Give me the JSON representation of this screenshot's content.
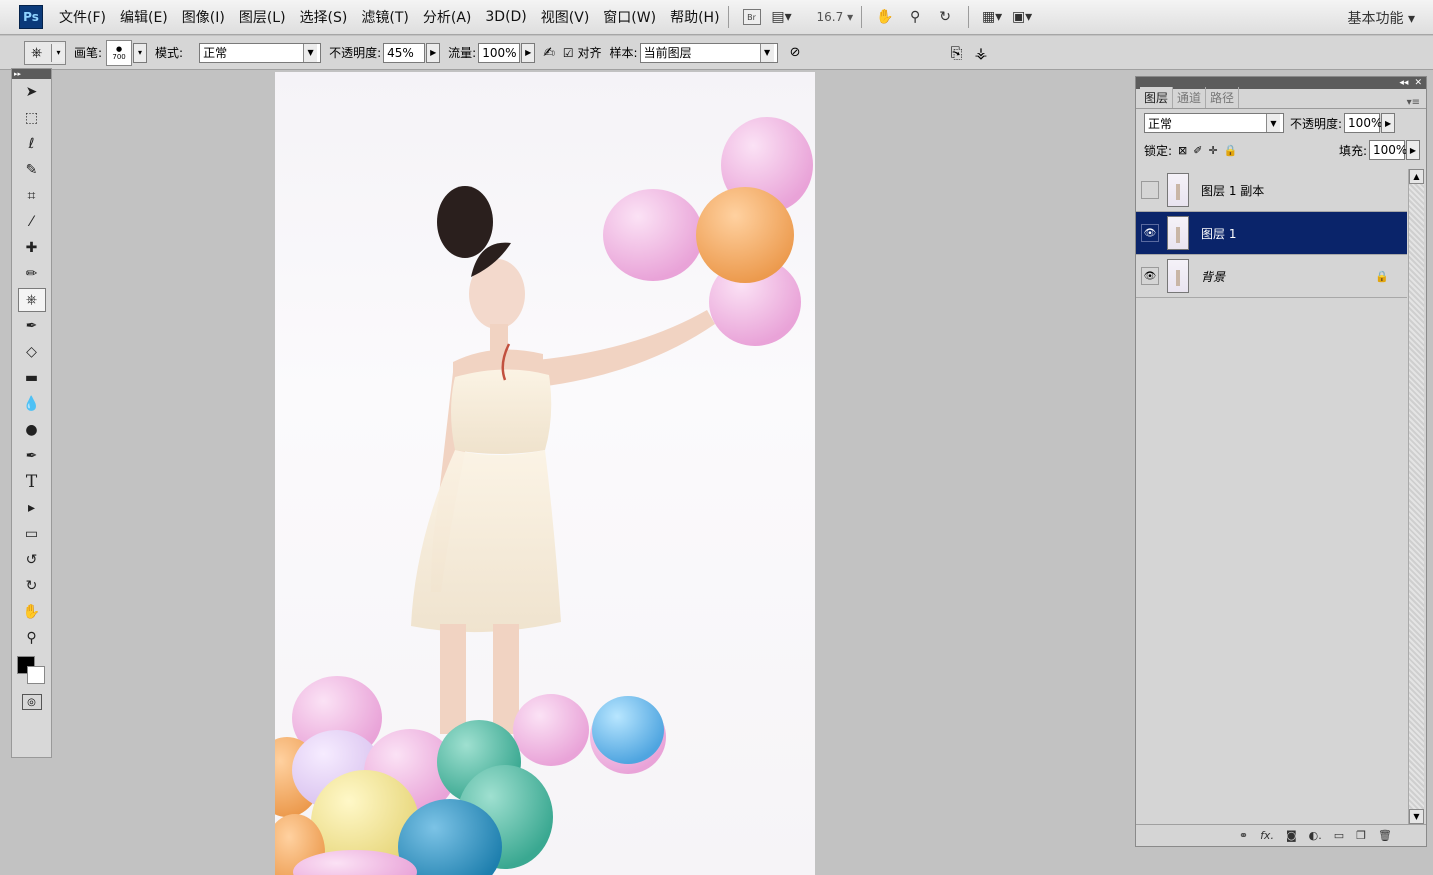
{
  "menubar": {
    "logo": "Ps",
    "menus": [
      "文件(F)",
      "编辑(E)",
      "图像(I)",
      "图层(L)",
      "选择(S)",
      "滤镜(T)",
      "分析(A)",
      "3D(D)",
      "视图(V)",
      "窗口(W)",
      "帮助(H)"
    ],
    "bridge_label": "Br",
    "zoom": "16.7",
    "workspace": "基本功能"
  },
  "options": {
    "brush_label": "画笔:",
    "brush_size": "700",
    "mode_label": "模式:",
    "mode_value": "正常",
    "opacity_label": "不透明度:",
    "opacity_value": "45%",
    "flow_label": "流量:",
    "flow_value": "100%",
    "aligned_label": "对齐",
    "sample_label": "样本:",
    "sample_value": "当前图层"
  },
  "layers_panel": {
    "tabs": [
      "图层",
      "通道",
      "路径"
    ],
    "blend_mode": "正常",
    "opacity_label": "不透明度:",
    "opacity_value": "100%",
    "lock_label": "锁定:",
    "fill_label": "填充:",
    "fill_value": "100%",
    "layers": [
      {
        "name": "图层 1 副本",
        "visible": false,
        "selected": false
      },
      {
        "name": "图层 1",
        "visible": true,
        "selected": true
      },
      {
        "name": "背景",
        "visible": true,
        "selected": false,
        "locked": true
      }
    ]
  },
  "colors": {
    "selection": "#0a246a",
    "foreground": "#000000",
    "background": "#ffffff"
  }
}
